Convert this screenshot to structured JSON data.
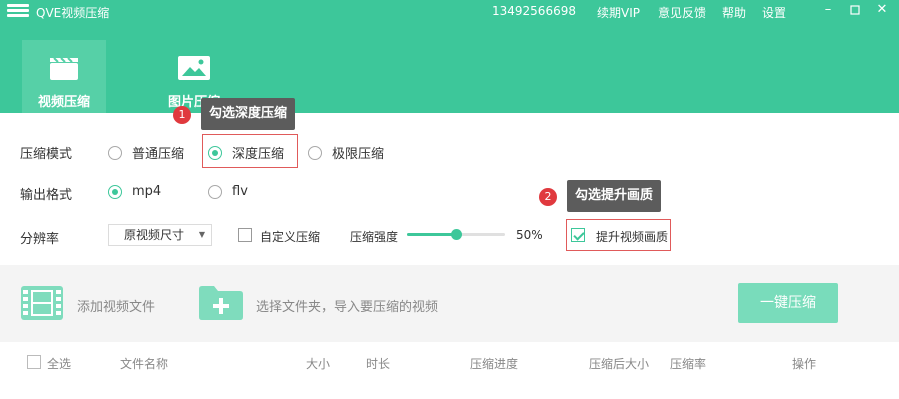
{
  "titlebar": {
    "app_title": "QVE视频压缩",
    "phone": "13492566698",
    "nav": [
      "续期VIP",
      "意见反馈",
      "帮助",
      "设置"
    ],
    "window_buttons": [
      "minimize",
      "maximize",
      "close"
    ]
  },
  "tabs": [
    {
      "label": "视频压缩",
      "icon": "clapperboard-icon",
      "active": true
    },
    {
      "label": "图片压缩",
      "icon": "image-icon",
      "active": false
    }
  ],
  "options": {
    "mode_label": "压缩模式",
    "modes": [
      {
        "label": "普通压缩",
        "checked": false
      },
      {
        "label": "深度压缩",
        "checked": true
      },
      {
        "label": "极限压缩",
        "checked": false
      }
    ],
    "format_label": "输出格式",
    "formats": [
      {
        "label": "mp4",
        "checked": true
      },
      {
        "label": "flv",
        "checked": false
      }
    ],
    "resolution_label": "分辨率",
    "resolution_value": "原视频尺寸",
    "custom_compress_label": "自定义压缩",
    "custom_compress_checked": false,
    "strength_label": "压缩强度",
    "strength_value": "50%",
    "strength_fraction": 0.5,
    "enhance_label": "提升视频画质",
    "enhance_checked": true
  },
  "toolbar": {
    "add_video_label": "添加视频文件",
    "select_folder_label": "选择文件夹，导入要压缩的视频",
    "compress_button": "一键压缩"
  },
  "table": {
    "select_all": "全选",
    "columns": [
      "文件名称",
      "大小",
      "时长",
      "压缩进度",
      "压缩后大小",
      "压缩率",
      "操作"
    ]
  },
  "annotations": [
    {
      "number": "1",
      "text": "勾选深度压缩"
    },
    {
      "number": "2",
      "text": "勾选提升画质"
    }
  ],
  "colors": {
    "accent": "#3dc79a",
    "active_tab": "#56d0a7",
    "button_disabled": "#79dcbb",
    "badge": "#e0393e",
    "highlight": "#e05a5a"
  }
}
